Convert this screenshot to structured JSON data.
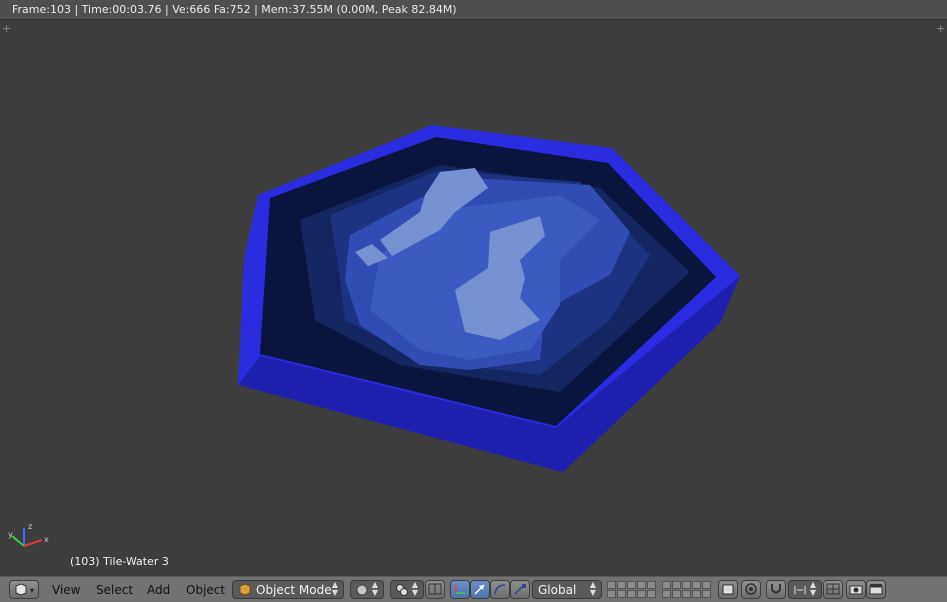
{
  "info_header": {
    "text": "Frame:103 | Time:00:03.76 | Ve:666 Fa:752 | Mem:37.55M (0.00M, Peak 82.84M)"
  },
  "viewport": {
    "object_label": "(103) Tile-Water 3",
    "axis_labels": {
      "x": "x",
      "y": "y",
      "z": "z"
    }
  },
  "toolbar": {
    "menus": {
      "view": "View",
      "select": "Select",
      "add": "Add",
      "object": "Object"
    },
    "mode": "Object Mode",
    "orientation": "Global"
  },
  "colors": {
    "tile_border": "#2a2ad6",
    "tile_inner": "#0f1a5a",
    "water_mid": "#27409a",
    "water_light": "#3a5cc0",
    "foam": "#6f8fd0"
  }
}
